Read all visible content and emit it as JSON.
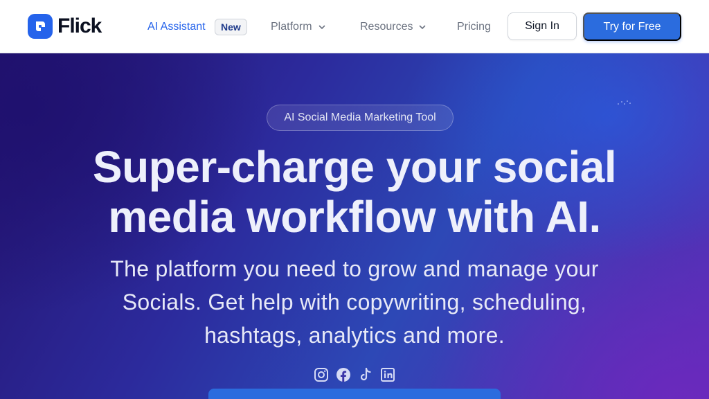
{
  "nav": {
    "brand": "Flick",
    "ai_assistant": "AI Assistant",
    "new_badge": "New",
    "platform": "Platform",
    "resources": "Resources",
    "pricing": "Pricing",
    "sign_in": "Sign In",
    "try_free": "Try for Free"
  },
  "hero": {
    "pill": "AI Social Media Marketing Tool",
    "headline_line1": "Super-charge your social",
    "headline_line2": "media workflow with AI.",
    "sub_line1": "The platform you need to grow and manage your",
    "sub_line2": "Socials. Get help with copywriting, scheduling,",
    "sub_line3": "hashtags, analytics and more.",
    "socials": [
      "instagram-icon",
      "facebook-icon",
      "tiktok-icon",
      "linkedin-icon"
    ]
  },
  "colors": {
    "brand_blue": "#2563eb",
    "button_blue": "#2b6cde",
    "text_dark": "#0b1020",
    "nav_gray": "#6b7280"
  }
}
